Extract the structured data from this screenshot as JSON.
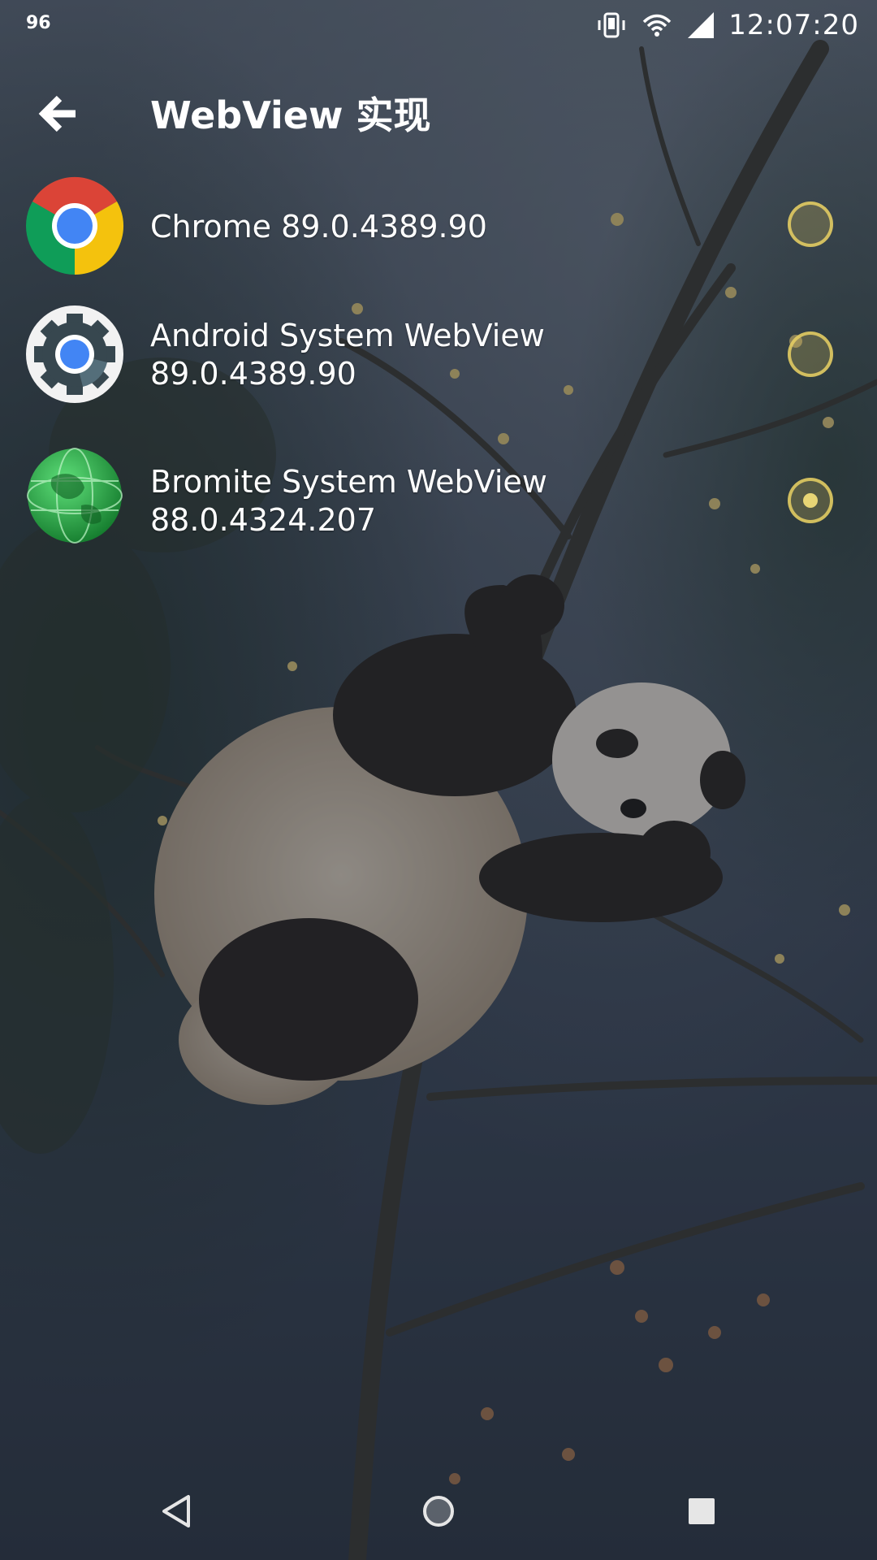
{
  "status_bar": {
    "left_text": "96",
    "time": "12:07:20",
    "icons": [
      "vibrate-icon",
      "wifi-icon",
      "cell-signal-icon"
    ]
  },
  "app_bar": {
    "back_icon": "arrow-back-icon",
    "title": "WebView 实现"
  },
  "providers": [
    {
      "name": "Chrome 89.0.4389.90",
      "version": "",
      "icon": "chrome-icon",
      "selected": false
    },
    {
      "name": "Android System WebView",
      "version": "89.0.4389.90",
      "icon": "android-webview-icon",
      "selected": false
    },
    {
      "name": "Bromite System WebView",
      "version": "88.0.4324.207",
      "icon": "bromite-icon",
      "selected": true
    }
  ],
  "nav_bar": {
    "buttons": [
      "back-triangle-icon",
      "home-circle-icon",
      "recents-square-icon"
    ]
  },
  "colors": {
    "radio_accent": "#e8d064",
    "chrome_red": "#db4437",
    "chrome_yellow": "#f4c20d",
    "chrome_green": "#0f9d58",
    "chrome_blue": "#4285f4",
    "bromite_green": "#2ea84a"
  }
}
